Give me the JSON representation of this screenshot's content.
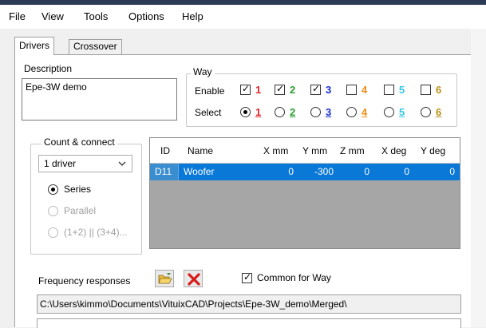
{
  "menu": [
    "File",
    "View",
    "Tools",
    "Options",
    "Help"
  ],
  "tabs": [
    {
      "label": "Drivers",
      "active": true
    },
    {
      "label": "Crossover",
      "active": false
    }
  ],
  "description": {
    "label": "Description",
    "value": "Epe-3W demo"
  },
  "way": {
    "title": "Way",
    "enable_label": "Enable",
    "select_label": "Select",
    "items": [
      {
        "num": "1",
        "color": "#e0262b",
        "enabled": true,
        "selected": true
      },
      {
        "num": "2",
        "color": "#2a9c2e",
        "enabled": true,
        "selected": false
      },
      {
        "num": "3",
        "color": "#1a2fd0",
        "enabled": true,
        "selected": false
      },
      {
        "num": "4",
        "color": "#f08c12",
        "enabled": false,
        "selected": false
      },
      {
        "num": "5",
        "color": "#36c6e6",
        "enabled": false,
        "selected": false
      },
      {
        "num": "6",
        "color": "#b89016",
        "enabled": false,
        "selected": false
      }
    ]
  },
  "count_connect": {
    "title": "Count & connect",
    "count_value": "1 driver",
    "options": [
      {
        "label": "Series",
        "selected": true,
        "enabled": true
      },
      {
        "label": "Parallel",
        "selected": false,
        "enabled": false
      },
      {
        "label": "(1+2) || (3+4)...",
        "selected": false,
        "enabled": false
      }
    ]
  },
  "drivers_table": {
    "columns": [
      "ID",
      "Name",
      "X mm",
      "Y mm",
      "Z mm",
      "X deg",
      "Y deg"
    ],
    "rows": [
      {
        "id": "D11",
        "name": "Woofer",
        "x_mm": "0",
        "y_mm": "-300",
        "z_mm": "0",
        "x_deg": "0",
        "y_deg": "0"
      }
    ]
  },
  "frequency": {
    "label": "Frequency responses",
    "common_label": "Common for Way",
    "common_checked": true,
    "path": "C:\\Users\\kimmo\\Documents\\VituixCAD\\Projects\\Epe-3W_demo\\Merged\\"
  },
  "icons": {
    "open": "folder-open-icon",
    "delete": "red-x-delete-icon",
    "dropdown": "chevron-down-icon"
  },
  "colors": {
    "selection": "#0a78d7",
    "titlebar": "#2b3a55",
    "grid_bg": "#a6a6a6"
  }
}
